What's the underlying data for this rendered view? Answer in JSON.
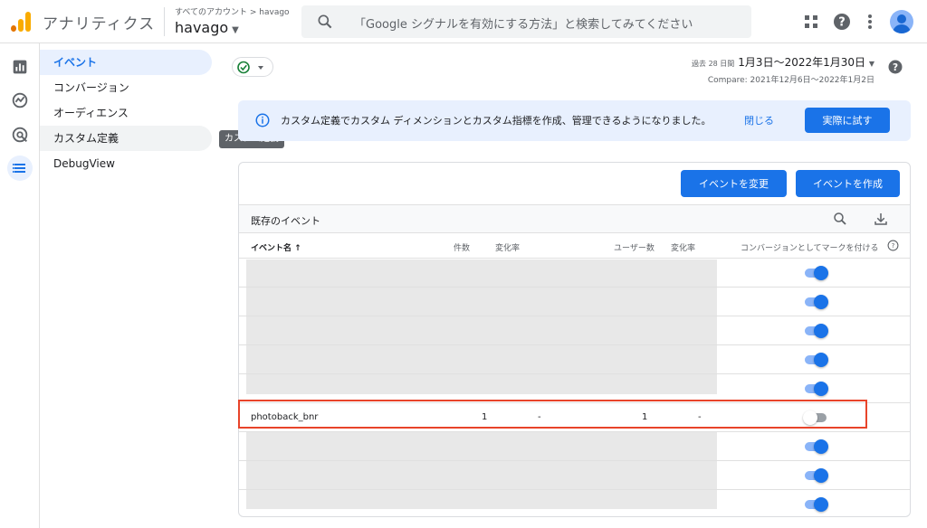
{
  "header": {
    "app_title": "アナリティクス",
    "breadcrumb": "すべてのアカウント > havago",
    "account_name": "havago",
    "search_placeholder": "「Google シグナルを有効にする方法」と検索してみてください"
  },
  "subnav": {
    "items": [
      {
        "label": "イベント",
        "active": true
      },
      {
        "label": "コンバージョン"
      },
      {
        "label": "オーディエンス"
      },
      {
        "label": "カスタム定義",
        "hover": true
      },
      {
        "label": "DebugView"
      }
    ],
    "tooltip": "カスタム定義"
  },
  "daterange": {
    "prefix": "過去 28 日間",
    "range": "1月3日〜2022年1月30日",
    "compare": "Compare: 2021年12月6日〜2022年1月2日"
  },
  "banner": {
    "message": "カスタム定義でカスタム ディメンションとカスタム指標を作成、管理できるようになりました。",
    "close": "閉じる",
    "try": "実際に試す"
  },
  "card": {
    "modify_button": "イベントを変更",
    "create_button": "イベントを作成",
    "section_title": "既存のイベント"
  },
  "table": {
    "headers": {
      "name": "イベント名 ↑",
      "count": "件数",
      "rate1": "変化率",
      "users": "ユーザー数",
      "rate2": "変化率",
      "conversion": "コンバージョンとしてマークを付ける"
    },
    "highlight_row": {
      "name": "photoback_bnr",
      "count": "1",
      "rate1": "-",
      "users": "1",
      "rate2": "-"
    },
    "toggles": [
      true,
      true,
      true,
      true,
      true,
      false,
      true,
      true,
      true
    ]
  },
  "colors": {
    "accent": "#1a73e8",
    "highlight": "#e8442a"
  }
}
